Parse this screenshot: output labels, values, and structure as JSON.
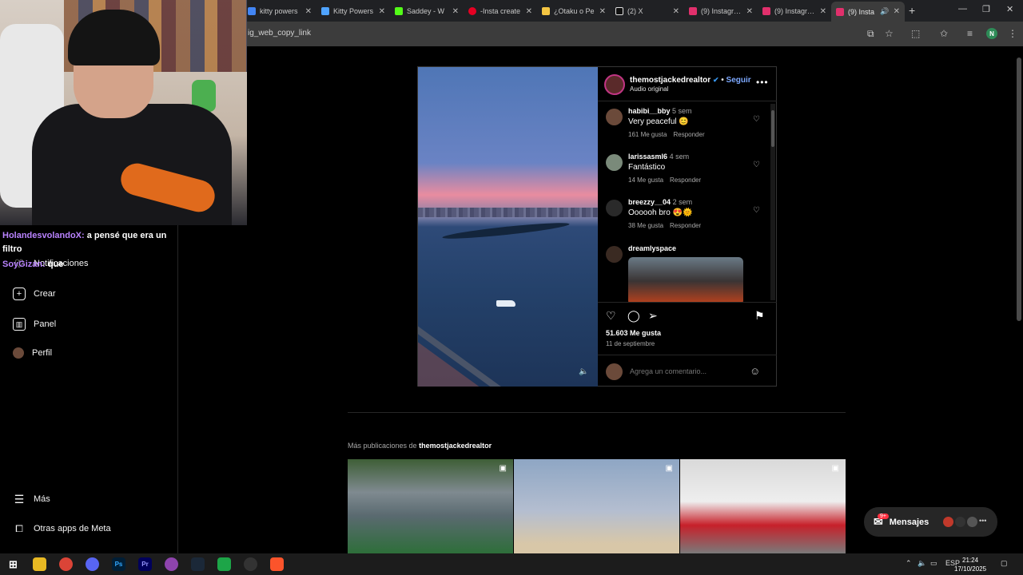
{
  "browser": {
    "tabs": [
      {
        "title": "kitty powers",
        "color": "#4285f4"
      },
      {
        "title": "Kitty Powers",
        "color": "#4fa3ff"
      },
      {
        "title": "Saddey - W",
        "color": "#53fc18"
      },
      {
        "title": "-Insta create",
        "color": "#e60023"
      },
      {
        "title": "¿Otaku o Pe",
        "color": "#f4c542"
      },
      {
        "title": "(2) X",
        "color": "#ffffff"
      },
      {
        "title": "(9) Instagram",
        "color": "#e1306c"
      },
      {
        "title": "(9) Instagram",
        "color": "#e1306c"
      },
      {
        "title": "(9) Insta",
        "color": "#e1306c"
      }
    ],
    "url": "ig_web_copy_link",
    "profile_initial": "N"
  },
  "chat": {
    "line1_user": "HolandesvolandoX:",
    "line1_text": "a pensé que era un filtro",
    "line2_user": "SoyGizan:",
    "line2_text": "que",
    "badge": "9+"
  },
  "sidebar": {
    "notifications": "Notificaciones",
    "create": "Crear",
    "panel": "Panel",
    "profile": "Perfil",
    "more": "Más",
    "meta_apps": "Otras apps de Meta"
  },
  "post": {
    "username": "themostjackedrealtor",
    "follow": "Seguir",
    "audio": "Audio original",
    "comments": [
      {
        "user": "habibi__bby",
        "time": "5 sem",
        "text": "Very peaceful 😊",
        "likes": "161 Me gusta",
        "reply": "Responder",
        "avatar": "#6b4a3a"
      },
      {
        "user": "larissasml6",
        "time": "4 sem",
        "text": "Fantástico",
        "likes": "14 Me gusta",
        "reply": "Responder",
        "avatar": "#7a8a7a"
      },
      {
        "user": "breezzy__04",
        "time": "2 sem",
        "text": "Oooooh bro 😍🌞",
        "likes": "38 Me gusta",
        "reply": "Responder",
        "avatar": "#2a2a2a"
      },
      {
        "user": "dreamlyspace",
        "time": "",
        "text": "",
        "likes": "",
        "reply": "",
        "avatar": "#3a2a22"
      }
    ],
    "likes": "51.603 Me gusta",
    "date": "11 de septiembre",
    "comment_placeholder": "Agrega un comentario..."
  },
  "more_posts": {
    "prefix": "Más publicaciones de",
    "user": "themostjackedrealtor"
  },
  "messages": {
    "label": "Mensajes",
    "badge": "9+"
  },
  "taskbar": {
    "lang": "ESP",
    "time": "21:24",
    "date": "17/10/2025"
  }
}
